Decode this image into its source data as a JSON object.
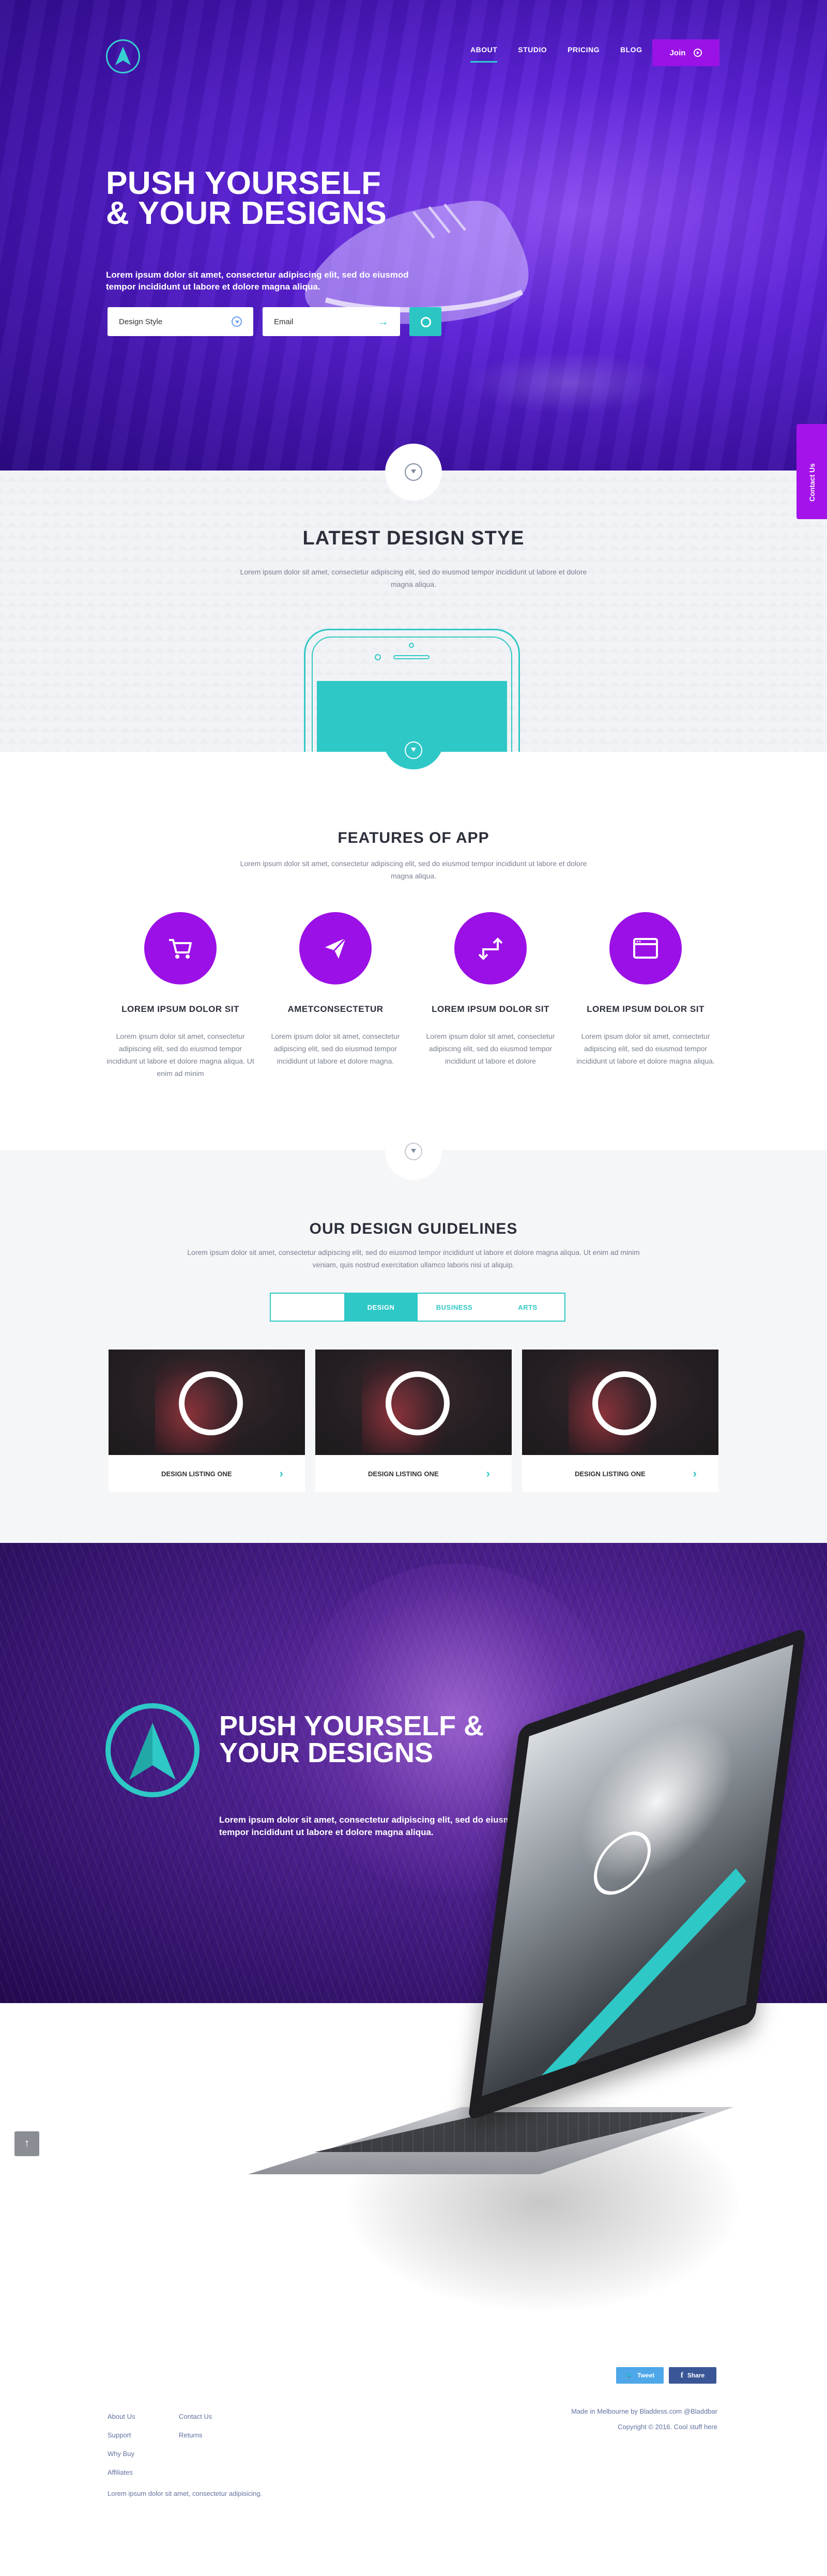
{
  "nav": {
    "items": [
      {
        "label": "ABOUT",
        "active": true
      },
      {
        "label": "STUDIO",
        "active": false
      },
      {
        "label": "PRICING",
        "active": false
      },
      {
        "label": "BLOG",
        "active": false
      }
    ],
    "join_label": "Join"
  },
  "hero": {
    "title": "PUSH YOURSELF & YOUR DESIGNS",
    "lead": "Lorem ipsum dolor sit amet, consectetur adipiscing elit, sed do eiusmod tempor incididunt ut labore et dolore magna aliqua.",
    "field_style": "Design Style",
    "field_email": "Email"
  },
  "contact_tab": "Contact Us",
  "latest": {
    "title": "LATEST DESIGN STYE",
    "sub": "Lorem ipsum dolor sit amet, consectetur adipiscing elit, sed do eiusmod tempor incididunt ut labore et dolore magna aliqua."
  },
  "features": {
    "title": "FEATURES OF APP",
    "sub": "Lorem ipsum dolor sit amet, consectetur adipiscing elit, sed do eiusmod tempor incididunt ut labore et dolore magna aliqua.",
    "items": [
      {
        "icon": "cart-icon",
        "title": "LOREM IPSUM DOLOR SIT",
        "text": "Lorem ipsum dolor sit amet, consectetur adipiscing elit, sed do eiusmod tempor incididunt ut labore et dolore magna aliqua. Ut enim ad minim"
      },
      {
        "icon": "paper-plane-icon",
        "title": "AMETCONSECTETUR",
        "text": "Lorem ipsum dolor sit amet, consectetur adipiscing elit, sed do eiusmod tempor incididunt ut labore et dolore magna."
      },
      {
        "icon": "swap-arrows-icon",
        "title": "LOREM IPSUM DOLOR SIT",
        "text": "Lorem ipsum dolor sit amet, consectetur adipiscing elit, sed do eiusmod tempor incididunt ut labore et dolore"
      },
      {
        "icon": "browser-window-icon",
        "title": "LOREM IPSUM DOLOR SIT",
        "text": "Lorem ipsum dolor sit amet, consectetur adipiscing elit, sed do eiusmod tempor incididunt ut labore et dolore magna aliqua."
      }
    ]
  },
  "guides": {
    "title": "OUR DESIGN GUIDELINES",
    "sub": "Lorem ipsum dolor sit amet, consectetur adipiscing elit, sed do eiusmod tempor incididunt ut labore et dolore magna aliqua. Ut enim ad minim veniam, quis nostrud exercitation ullamco laboris nisi ut aliquip.",
    "tabs": [
      {
        "label": "",
        "active": false
      },
      {
        "label": "DESIGN",
        "active": true
      },
      {
        "label": "BUSINESS",
        "active": false
      },
      {
        "label": "ARTS",
        "active": false
      }
    ],
    "cards": [
      "DESIGN LISTING  ONE",
      "DESIGN LISTING  ONE",
      "DESIGN LISTING  ONE"
    ]
  },
  "banner": {
    "title": "PUSH YOURSELF & YOUR DESIGNS",
    "lead": "Lorem ipsum dolor sit amet, consectetur adipiscing elit, sed do eiusmod tempor incididunt ut labore et dolore magna aliqua."
  },
  "footer": {
    "tweet": "Tweet",
    "share": "Share",
    "col1": [
      "About Us",
      "Support",
      "Why Buy",
      "Affiliates"
    ],
    "col2": [
      "Contact Us",
      "Returns"
    ],
    "made_in": "Made in Melbourne by Bladdess.com @Bladdbar",
    "copyright": "Copyright © 2016. Cool stuff here",
    "note": "Lorem ipsum dolor sit amet, consectetur adipisicing."
  },
  "colors": {
    "purple": "#9b10e6",
    "teal": "#2ec8c6",
    "hero_bg": "#5c21d8"
  }
}
